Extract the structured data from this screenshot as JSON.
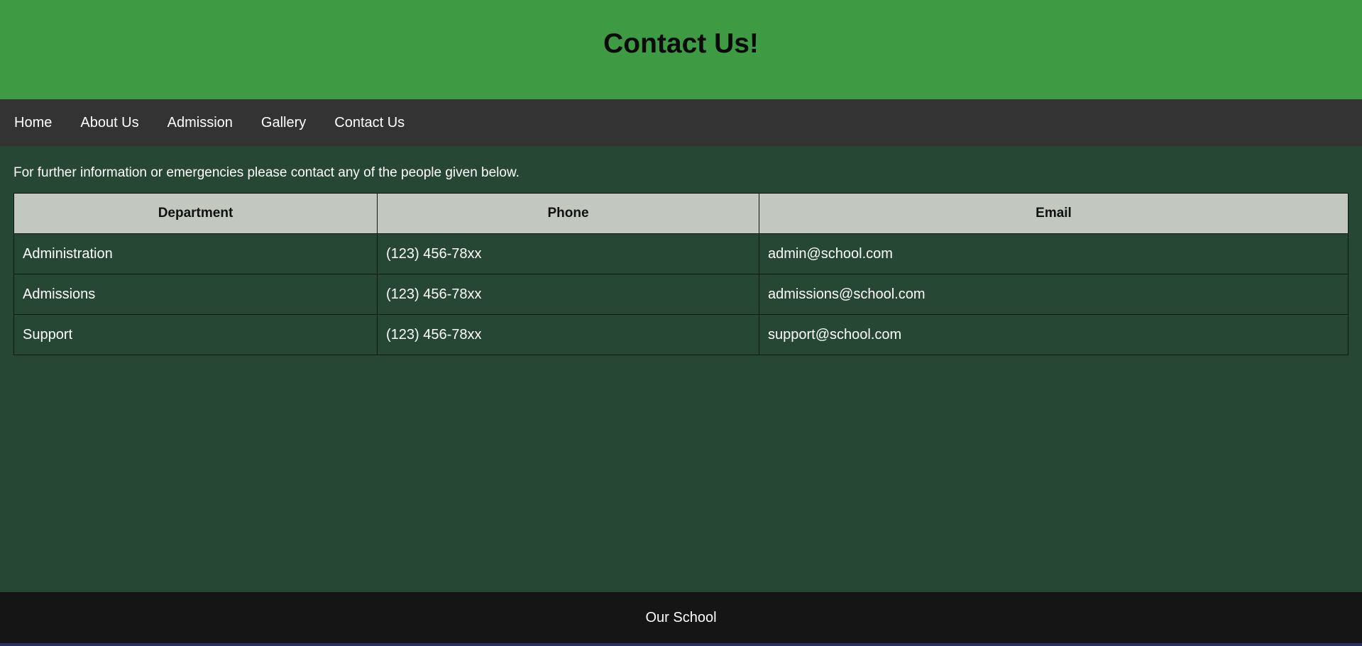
{
  "header": {
    "title": "Contact Us!"
  },
  "nav": {
    "items": [
      {
        "label": "Home"
      },
      {
        "label": "About Us"
      },
      {
        "label": "Admission"
      },
      {
        "label": "Gallery"
      },
      {
        "label": "Contact Us"
      }
    ]
  },
  "main": {
    "intro": "For further information or emergencies please contact any of the people given below.",
    "table": {
      "headers": [
        "Department",
        "Phone",
        "Email"
      ],
      "rows": [
        [
          "Administration",
          "(123) 456-78xx",
          "admin@school.com"
        ],
        [
          "Admissions",
          "(123) 456-78xx",
          "admissions@school.com"
        ],
        [
          "Support",
          "(123) 456-78xx",
          "support@school.com"
        ]
      ]
    }
  },
  "footer": {
    "text": "Our School"
  },
  "colors": {
    "header_bg": "#3e9a43",
    "nav_bg": "#333333",
    "page_bg": "#264733",
    "table_header_bg": "#c2c8c0",
    "footer_bg": "#151515"
  }
}
